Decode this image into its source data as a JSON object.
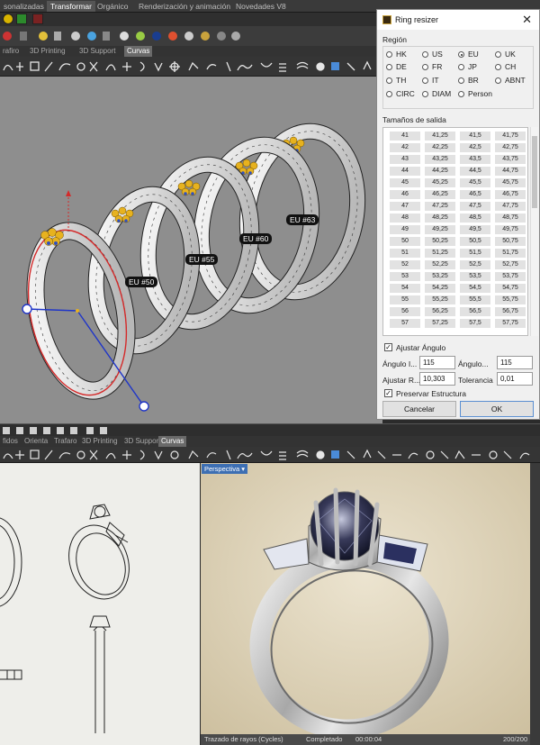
{
  "top_tabs": [
    {
      "label": "sonalizadas",
      "active": false
    },
    {
      "label": "Transformar",
      "active": true
    },
    {
      "label": "Orgánico",
      "active": false
    },
    {
      "label": "Renderización y animación",
      "active": false
    },
    {
      "label": "Novedades V8",
      "active": false
    }
  ],
  "subtabs_top": [
    {
      "label": "rafiro",
      "active": false
    },
    {
      "label": "3D Printing",
      "active": false
    },
    {
      "label": "3D Support",
      "active": false
    },
    {
      "label": "Curvas",
      "active": true
    }
  ],
  "ring_labels": [
    "EU #50",
    "EU #55",
    "EU #60",
    "EU #63"
  ],
  "dialog": {
    "title": "Ring resizer",
    "region_label": "Región",
    "regions": [
      {
        "label": "HK",
        "selected": false
      },
      {
        "label": "US",
        "selected": false
      },
      {
        "label": "EU",
        "selected": true
      },
      {
        "label": "UK",
        "selected": false
      },
      {
        "label": "DE",
        "selected": false
      },
      {
        "label": "FR",
        "selected": false
      },
      {
        "label": "JP",
        "selected": false
      },
      {
        "label": "CH",
        "selected": false
      },
      {
        "label": "TH",
        "selected": false
      },
      {
        "label": "IT",
        "selected": false
      },
      {
        "label": "BR",
        "selected": false
      },
      {
        "label": "ABNT",
        "selected": false
      },
      {
        "label": "CIRC",
        "selected": false
      },
      {
        "label": "DIAM",
        "selected": false
      },
      {
        "label": "Person",
        "selected": false
      }
    ],
    "sizes_label": "Tamaños de salida",
    "sizes": [
      [
        "41",
        "41,25",
        "41,5",
        "41,75"
      ],
      [
        "42",
        "42,25",
        "42,5",
        "42,75"
      ],
      [
        "43",
        "43,25",
        "43,5",
        "43,75"
      ],
      [
        "44",
        "44,25",
        "44,5",
        "44,75"
      ],
      [
        "45",
        "45,25",
        "45,5",
        "45,75"
      ],
      [
        "46",
        "46,25",
        "46,5",
        "46,75"
      ],
      [
        "47",
        "47,25",
        "47,5",
        "47,75"
      ],
      [
        "48",
        "48,25",
        "48,5",
        "48,75"
      ],
      [
        "49",
        "49,25",
        "49,5",
        "49,75"
      ],
      [
        "50",
        "50,25",
        "50,5",
        "50,75"
      ],
      [
        "51",
        "51,25",
        "51,5",
        "51,75"
      ],
      [
        "52",
        "52,25",
        "52,5",
        "52,75"
      ],
      [
        "53",
        "53,25",
        "53,5",
        "53,75"
      ],
      [
        "54",
        "54,25",
        "54,5",
        "54,75"
      ],
      [
        "55",
        "55,25",
        "55,5",
        "55,75"
      ],
      [
        "56",
        "56,25",
        "56,5",
        "56,75"
      ],
      [
        "57",
        "57,25",
        "57,5",
        "57,75"
      ]
    ],
    "adjust_angle_label": "Ajustar Ángulo",
    "adjust_angle_checked": true,
    "angle_i_label": "Ángulo I...",
    "angle_i_value": "115",
    "angle_2_label": "Ángulo...",
    "angle_2_value": "115",
    "adjust_r_label": "Ajustar R...",
    "adjust_r_value": "10,303",
    "tolerance_label": "Tolerancia",
    "tolerance_value": "0,01",
    "preserve_label": "Preservar Estructura",
    "preserve_checked": true,
    "cancel_label": "Cancelar",
    "ok_label": "OK"
  },
  "subtabs_bottom": [
    {
      "label": "fidos",
      "active": false
    },
    {
      "label": "Orienta",
      "active": false
    },
    {
      "label": "Trafaro",
      "active": false
    },
    {
      "label": "3D Printing",
      "active": false
    },
    {
      "label": "3D Support",
      "active": false
    },
    {
      "label": "Curvas",
      "active": true
    }
  ],
  "render_viewport": {
    "label": "Perspectiva",
    "status_mode": "Trazado de rayos (Cycles)",
    "status_state": "Completado",
    "status_time": "00:00:04",
    "status_samples": "200/200"
  },
  "colors": {
    "dialog_bg": "#f0f0f0",
    "viewport_bg": "#8e8e8e",
    "selection_red": "#d42a2a",
    "gizmo_blue": "#1f35c8",
    "prong_yellow": "#e7b21f",
    "accent_blue": "#3d6fb3"
  }
}
